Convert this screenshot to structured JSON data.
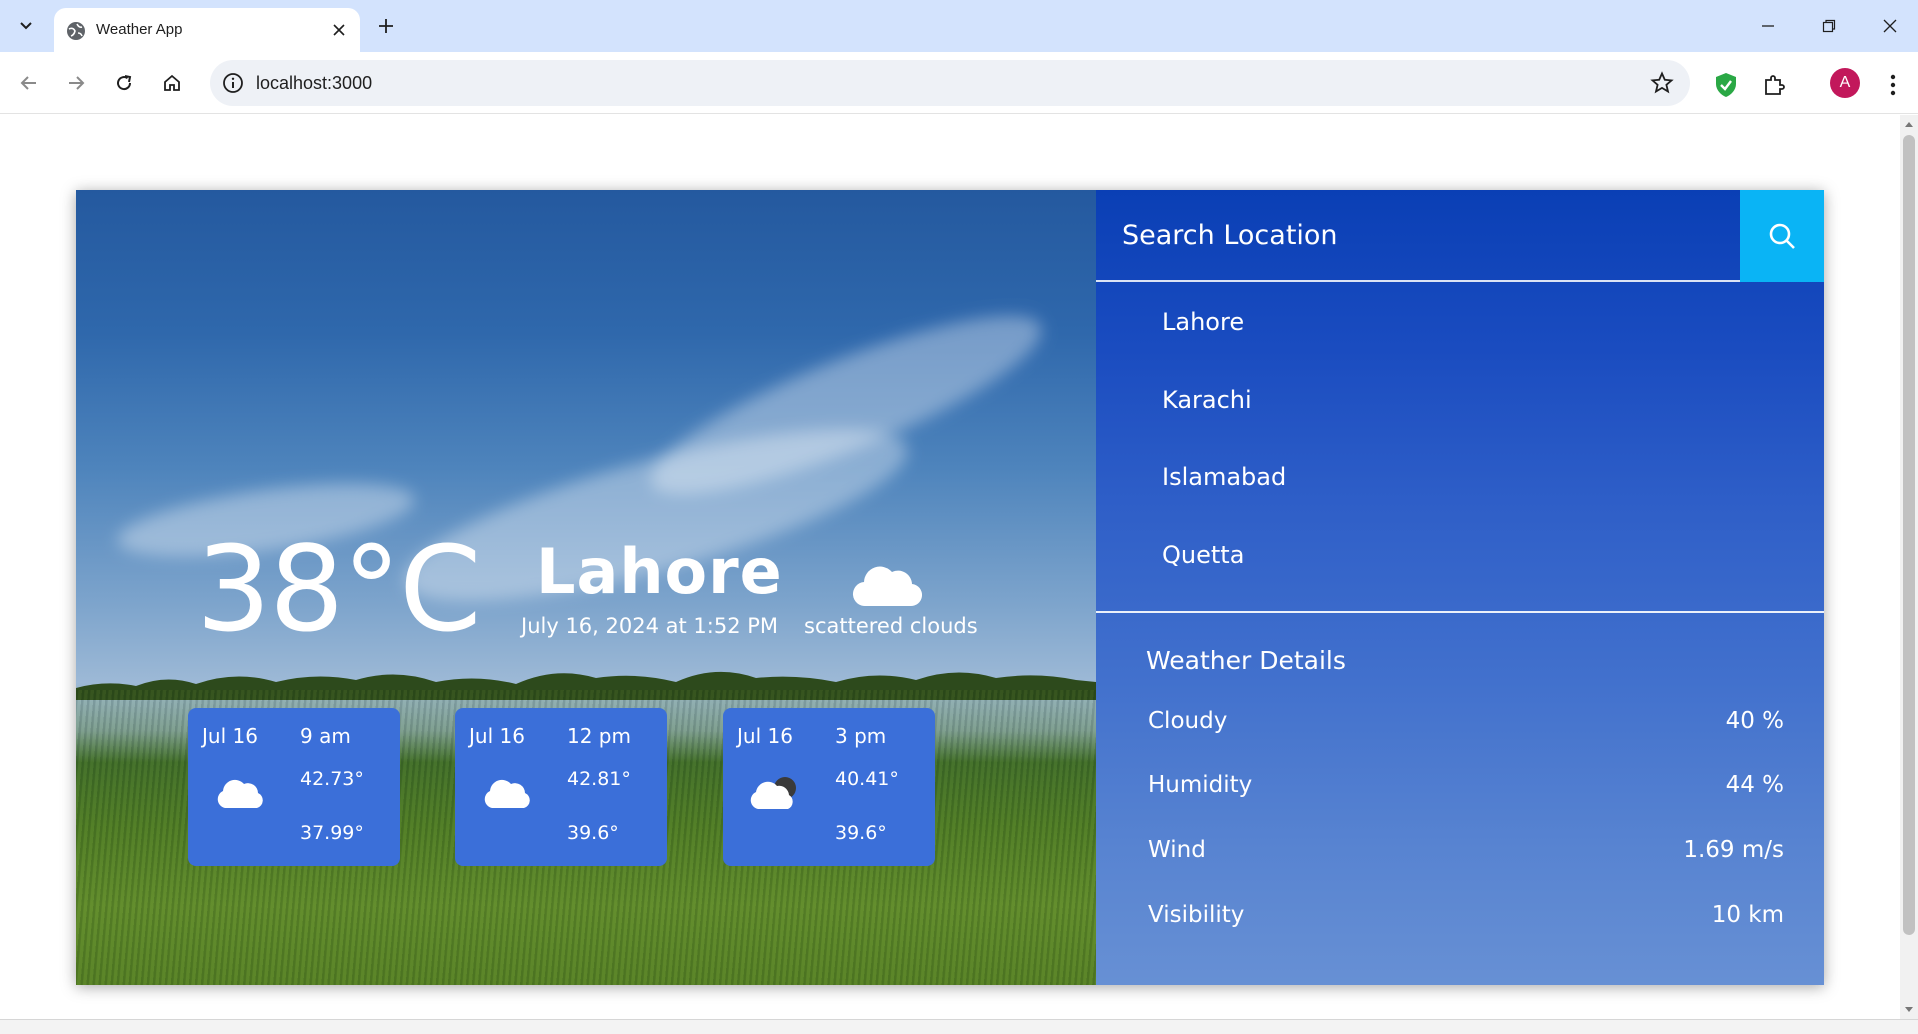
{
  "browser": {
    "tab_title": "Weather App",
    "url": "localhost:3000",
    "profile_initial": "A"
  },
  "current": {
    "temperature": "38°C",
    "city": "Lahore",
    "datetime": "July 16, 2024 at 1:52 PM",
    "condition": "scattered clouds",
    "condition_icon": "cloud-icon"
  },
  "forecast": [
    {
      "date": "Jul 16",
      "time": "9 am",
      "high": "42.73°",
      "low": "37.99°",
      "icon": "cloud-icon"
    },
    {
      "date": "Jul 16",
      "time": "12 pm",
      "high": "42.81°",
      "low": "39.6°",
      "icon": "cloud-icon"
    },
    {
      "date": "Jul 16",
      "time": "3 pm",
      "high": "40.41°",
      "low": "39.6°",
      "icon": "partly-cloudy-icon"
    }
  ],
  "search": {
    "placeholder": "Search Location"
  },
  "locations": [
    "Lahore",
    "Karachi",
    "Islamabad",
    "Quetta"
  ],
  "details": {
    "title": "Weather Details",
    "rows": [
      {
        "label": "Cloudy",
        "value": "40 %"
      },
      {
        "label": "Humidity",
        "value": "44 %"
      },
      {
        "label": "Wind",
        "value": "1.69 m/s"
      },
      {
        "label": "Visibility",
        "value": "10 km"
      }
    ]
  },
  "colors": {
    "chrome_tabbar": "#d3e3fd",
    "sidebar_top": "#0a3fb5",
    "sidebar_bottom": "#6790d4",
    "search_button": "#0ab4f5",
    "forecast_card": "#3b6fd9"
  }
}
